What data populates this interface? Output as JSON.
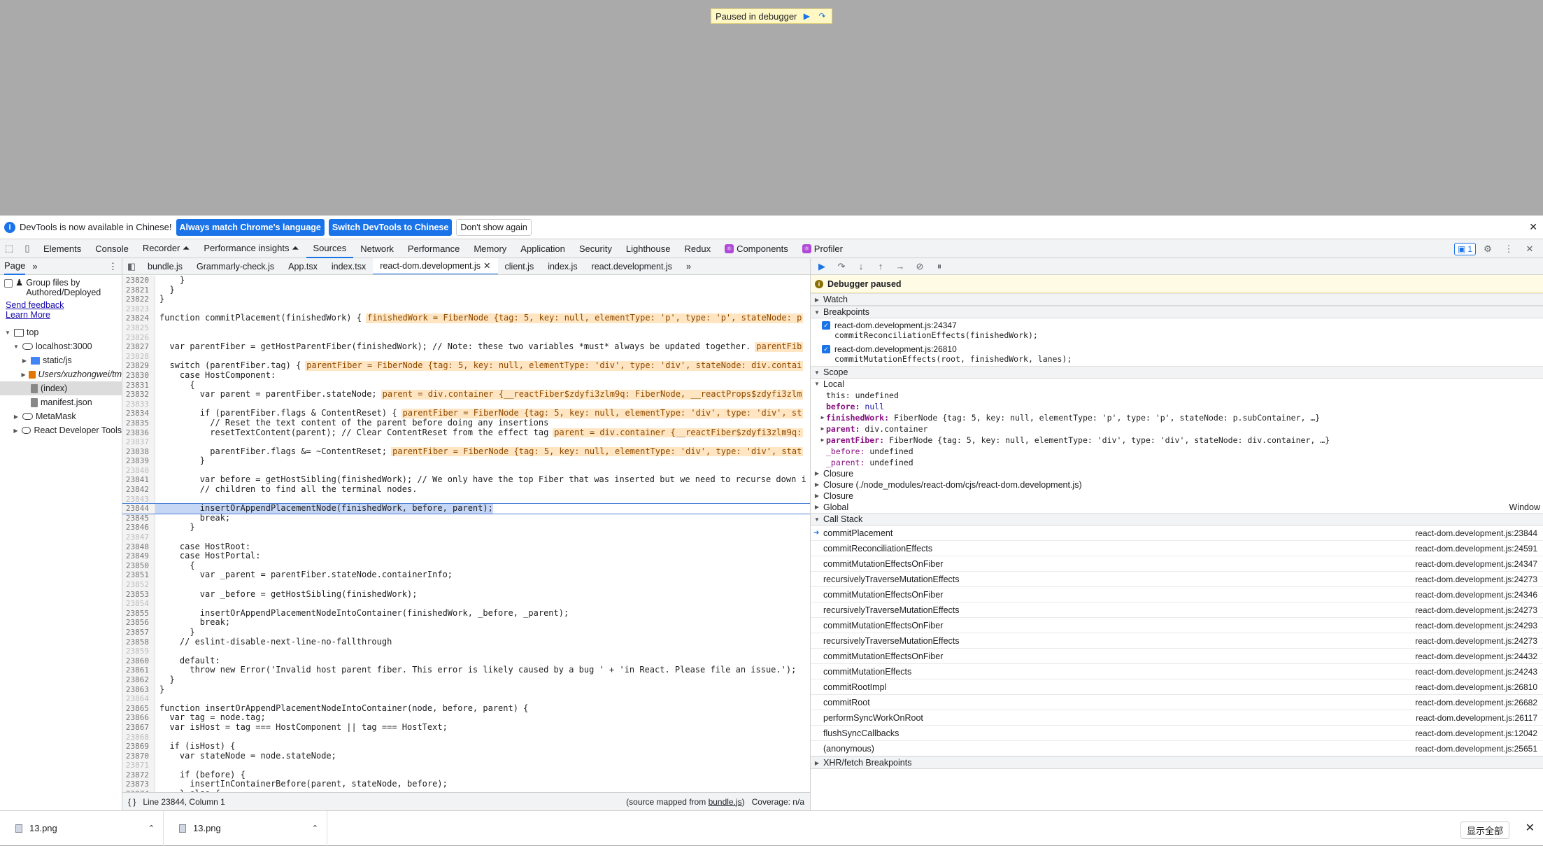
{
  "viewport": {
    "paused_text": "Paused in debugger"
  },
  "infobar": {
    "message": "DevTools is now available in Chinese!",
    "btn_match": "Always match Chrome's language",
    "btn_switch": "Switch DevTools to Chinese",
    "btn_dont_show": "Don't show again"
  },
  "tabs": [
    "Elements",
    "Console",
    "Recorder ⏶",
    "Performance insights ⏶",
    "Sources",
    "Network",
    "Performance",
    "Memory",
    "Application",
    "Security",
    "Lighthouse",
    "Redux"
  ],
  "tab_components": "Components",
  "tab_profiler": "Profiler",
  "issues_count": "1",
  "left": {
    "page_tab": "Page",
    "group_label": "Group files by Authored/Deployed",
    "send_feedback": "Send feedback",
    "learn_more": "Learn More",
    "tree": [
      {
        "label": "top",
        "indent": 0,
        "icon": "frame",
        "tri": "▼"
      },
      {
        "label": "localhost:3000",
        "indent": 1,
        "icon": "cloud",
        "tri": "▼"
      },
      {
        "label": "static/js",
        "indent": 2,
        "icon": "blue",
        "tri": "▶"
      },
      {
        "label": "Users/xuzhongwei/tm",
        "indent": 2,
        "icon": "orange",
        "tri": "▶",
        "italic": true
      },
      {
        "label": "(index)",
        "indent": 2,
        "icon": "file",
        "tri": "",
        "sel": true
      },
      {
        "label": "manifest.json",
        "indent": 2,
        "icon": "file",
        "tri": ""
      },
      {
        "label": "MetaMask",
        "indent": 1,
        "icon": "cloud",
        "tri": "▶"
      },
      {
        "label": "React Developer Tools",
        "indent": 1,
        "icon": "cloud",
        "tri": "▶"
      }
    ]
  },
  "editor": {
    "tabs": [
      "bundle.js",
      "Grammarly-check.js",
      "App.tsx",
      "index.tsx",
      "react-dom.development.js",
      "client.js",
      "index.js",
      "react.development.js"
    ],
    "active_tab": "react-dom.development.js",
    "status_left": "Line 23844, Column 1",
    "status_mapped": "(source mapped from ",
    "status_bundle": "bundle.js",
    "status_close": ")",
    "status_coverage": "Coverage: n/a",
    "lines": [
      {
        "n": "23820",
        "t": "    }"
      },
      {
        "n": "23821",
        "t": "  }"
      },
      {
        "n": "23822",
        "t": "}"
      },
      {
        "n": "23823",
        "t": "",
        "dim": true
      },
      {
        "n": "23824",
        "t": "function commitPlacement(finishedWork) {",
        "iv": "finishedWork = FiberNode {tag: 5, key: null, elementType: 'p', type: 'p', stateNode: p"
      },
      {
        "n": "23825",
        "t": "",
        "dim": true
      },
      {
        "n": "23826",
        "t": "",
        "dim": true
      },
      {
        "n": "23827",
        "t": "  var parentFiber = getHostParentFiber(finishedWork); // Note: these two variables *must* always be updated together.",
        "iv": "parentFib"
      },
      {
        "n": "23828",
        "t": "",
        "dim": true
      },
      {
        "n": "23829",
        "t": "  switch (parentFiber.tag) {",
        "iv": "parentFiber = FiberNode {tag: 5, key: null, elementType: 'div', type: 'div', stateNode: div.contai"
      },
      {
        "n": "23830",
        "t": "    case HostComponent:"
      },
      {
        "n": "23831",
        "t": "      {"
      },
      {
        "n": "23832",
        "t": "        var parent = parentFiber.stateNode;",
        "iv": "parent = div.container {__reactFiber$zdyfi3zlm9q: FiberNode, __reactProps$zdyfi3zlm"
      },
      {
        "n": "23833",
        "t": "",
        "dim": true
      },
      {
        "n": "23834",
        "t": "        if (parentFiber.flags & ContentReset) {",
        "iv": "parentFiber = FiberNode {tag: 5, key: null, elementType: 'div', type: 'div', st"
      },
      {
        "n": "23835",
        "t": "          // Reset the text content of the parent before doing any insertions"
      },
      {
        "n": "23836",
        "t": "          resetTextContent(parent); // Clear ContentReset from the effect tag",
        "iv": "parent = div.container {__reactFiber$zdyfi3zlm9q:"
      },
      {
        "n": "23837",
        "t": "",
        "dim": true
      },
      {
        "n": "23838",
        "t": "          parentFiber.flags &= ~ContentReset;",
        "iv": "parentFiber = FiberNode {tag: 5, key: null, elementType: 'div', type: 'div', stat"
      },
      {
        "n": "23839",
        "t": "        }"
      },
      {
        "n": "23840",
        "t": "",
        "dim": true
      },
      {
        "n": "23841",
        "t": "        var before = getHostSibling(finishedWork); // We only have the top Fiber that was inserted but we need to recurse down i"
      },
      {
        "n": "23842",
        "t": "        // children to find all the terminal nodes."
      },
      {
        "n": "23843",
        "t": "",
        "dim": true
      },
      {
        "n": "23844",
        "t": "        insertOrAppendPlacementNode(finishedWork, before, parent);",
        "hl": true
      },
      {
        "n": "23845",
        "t": "        break;"
      },
      {
        "n": "23846",
        "t": "      }"
      },
      {
        "n": "23847",
        "t": "",
        "dim": true
      },
      {
        "n": "23848",
        "t": "    case HostRoot:"
      },
      {
        "n": "23849",
        "t": "    case HostPortal:"
      },
      {
        "n": "23850",
        "t": "      {"
      },
      {
        "n": "23851",
        "t": "        var _parent = parentFiber.stateNode.containerInfo;"
      },
      {
        "n": "23852",
        "t": "",
        "dim": true
      },
      {
        "n": "23853",
        "t": "        var _before = getHostSibling(finishedWork);"
      },
      {
        "n": "23854",
        "t": "",
        "dim": true
      },
      {
        "n": "23855",
        "t": "        insertOrAppendPlacementNodeIntoContainer(finishedWork, _before, _parent);"
      },
      {
        "n": "23856",
        "t": "        break;"
      },
      {
        "n": "23857",
        "t": "      }"
      },
      {
        "n": "23858",
        "t": "    // eslint-disable-next-line-no-fallthrough"
      },
      {
        "n": "23859",
        "t": "",
        "dim": true
      },
      {
        "n": "23860",
        "t": "    default:"
      },
      {
        "n": "23861",
        "t": "      throw new Error('Invalid host parent fiber. This error is likely caused by a bug ' + 'in React. Please file an issue.');"
      },
      {
        "n": "23862",
        "t": "  }"
      },
      {
        "n": "23863",
        "t": "}"
      },
      {
        "n": "23864",
        "t": "",
        "dim": true
      },
      {
        "n": "23865",
        "t": "function insertOrAppendPlacementNodeIntoContainer(node, before, parent) {"
      },
      {
        "n": "23866",
        "t": "  var tag = node.tag;"
      },
      {
        "n": "23867",
        "t": "  var isHost = tag === HostComponent || tag === HostText;"
      },
      {
        "n": "23868",
        "t": "",
        "dim": true
      },
      {
        "n": "23869",
        "t": "  if (isHost) {"
      },
      {
        "n": "23870",
        "t": "    var stateNode = node.stateNode;"
      },
      {
        "n": "23871",
        "t": "",
        "dim": true
      },
      {
        "n": "23872",
        "t": "    if (before) {"
      },
      {
        "n": "23873",
        "t": "      insertInContainerBefore(parent, stateNode, before);"
      },
      {
        "n": "23874",
        "t": "    } else {"
      }
    ]
  },
  "debugger": {
    "paused_label": "Debugger paused",
    "watch": "Watch",
    "breakpoints": "Breakpoints",
    "bp_list": [
      {
        "file": "react-dom.development.js:24347",
        "code": "commitReconciliationEffects(finishedWork);"
      },
      {
        "file": "react-dom.development.js:26810",
        "code": "commitMutationEffects(root, finishedWork, lanes);"
      }
    ],
    "scope": "Scope",
    "local": "Local",
    "this_key": "this:",
    "this_val": "undefined",
    "before_key": "before:",
    "before_val": "null",
    "fw_key": "finishedWork:",
    "fw_val": "FiberNode {tag: 5, key: null, elementType: 'p', type: 'p', stateNode: p.subContainer, …}",
    "parent_key": "parent:",
    "parent_val": "div.container",
    "pf_key": "parentFiber:",
    "pf_val": "FiberNode {tag: 5, key: null, elementType: 'div', type: 'div', stateNode: div.container, …}",
    "ub_key": "_before:",
    "ub_val": "undefined",
    "up_key": "_parent:",
    "up_val": "undefined",
    "closure1": "Closure",
    "closure2": "Closure (./node_modules/react-dom/cjs/react-dom.development.js)",
    "closure3": "Closure",
    "global": "Global",
    "global_val": "Window",
    "callstack": "Call Stack",
    "frames": [
      {
        "fn": "commitPlacement",
        "loc": "react-dom.development.js:23844",
        "cur": true
      },
      {
        "fn": "commitReconciliationEffects",
        "loc": "react-dom.development.js:24591"
      },
      {
        "fn": "commitMutationEffectsOnFiber",
        "loc": "react-dom.development.js:24347"
      },
      {
        "fn": "recursivelyTraverseMutationEffects",
        "loc": "react-dom.development.js:24273"
      },
      {
        "fn": "commitMutationEffectsOnFiber",
        "loc": "react-dom.development.js:24346"
      },
      {
        "fn": "recursivelyTraverseMutationEffects",
        "loc": "react-dom.development.js:24273"
      },
      {
        "fn": "commitMutationEffectsOnFiber",
        "loc": "react-dom.development.js:24293"
      },
      {
        "fn": "recursivelyTraverseMutationEffects",
        "loc": "react-dom.development.js:24273"
      },
      {
        "fn": "commitMutationEffectsOnFiber",
        "loc": "react-dom.development.js:24432"
      },
      {
        "fn": "commitMutationEffects",
        "loc": "react-dom.development.js:24243"
      },
      {
        "fn": "commitRootImpl",
        "loc": "react-dom.development.js:26810"
      },
      {
        "fn": "commitRoot",
        "loc": "react-dom.development.js:26682"
      },
      {
        "fn": "performSyncWorkOnRoot",
        "loc": "react-dom.development.js:26117"
      },
      {
        "fn": "flushSyncCallbacks",
        "loc": "react-dom.development.js:12042"
      },
      {
        "fn": "(anonymous)",
        "loc": "react-dom.development.js:25651"
      }
    ],
    "xhr": "XHR/fetch Breakpoints"
  },
  "downloads": {
    "items": [
      "13.png",
      "13.png"
    ],
    "show_all": "显示全部"
  }
}
